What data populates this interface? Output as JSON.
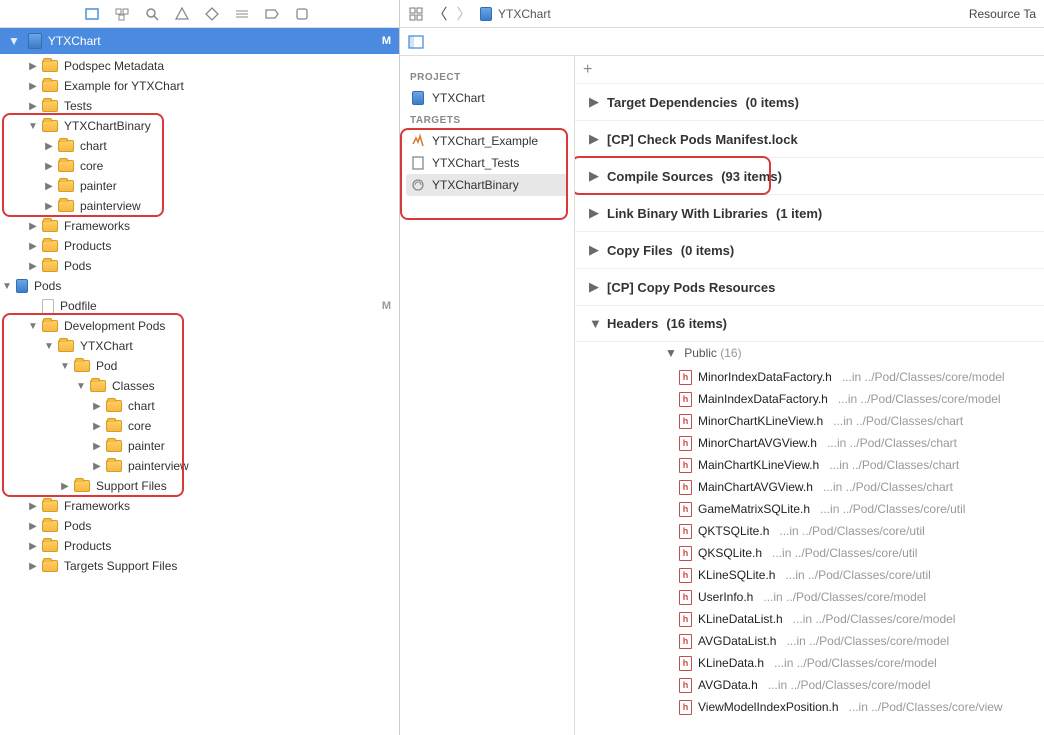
{
  "header": {
    "project_root": "YTXChart",
    "badge": "M",
    "resource_tag": "Resource Ta"
  },
  "crumb": {
    "item": "YTXChart"
  },
  "sidebar": {
    "tree1": [
      {
        "indent": 0,
        "open": false,
        "icon": "folder",
        "label": "Podspec Metadata"
      },
      {
        "indent": 0,
        "open": false,
        "icon": "folder",
        "label": "Example for YTXChart"
      },
      {
        "indent": 0,
        "open": false,
        "icon": "folder",
        "label": "Tests"
      }
    ],
    "tree_binary": [
      {
        "indent": 0,
        "open": true,
        "icon": "folder",
        "label": "YTXChartBinary"
      },
      {
        "indent": 1,
        "open": false,
        "icon": "folder",
        "label": "chart"
      },
      {
        "indent": 1,
        "open": false,
        "icon": "folder",
        "label": "core"
      },
      {
        "indent": 1,
        "open": false,
        "icon": "folder",
        "label": "painter"
      },
      {
        "indent": 1,
        "open": false,
        "icon": "folder",
        "label": "painterview"
      }
    ],
    "tree2": [
      {
        "indent": 0,
        "open": false,
        "icon": "folder",
        "label": "Frameworks"
      },
      {
        "indent": 0,
        "open": false,
        "icon": "folder",
        "label": "Products"
      },
      {
        "indent": 0,
        "open": false,
        "icon": "folder",
        "label": "Pods"
      }
    ],
    "pods_root": {
      "label": "Pods"
    },
    "podfile": {
      "label": "Podfile",
      "badge": "M"
    },
    "dev_pods": [
      {
        "indent": 0,
        "open": true,
        "icon": "folder",
        "label": "Development Pods"
      },
      {
        "indent": 1,
        "open": true,
        "icon": "folder",
        "label": "YTXChart"
      },
      {
        "indent": 2,
        "open": true,
        "icon": "folder",
        "label": "Pod"
      },
      {
        "indent": 3,
        "open": true,
        "icon": "folder",
        "label": "Classes"
      },
      {
        "indent": 4,
        "open": false,
        "icon": "folder",
        "label": "chart"
      },
      {
        "indent": 4,
        "open": false,
        "icon": "folder",
        "label": "core"
      },
      {
        "indent": 4,
        "open": false,
        "icon": "folder",
        "label": "painter"
      },
      {
        "indent": 4,
        "open": false,
        "icon": "folder",
        "label": "painterview"
      },
      {
        "indent": 2,
        "open": false,
        "icon": "folder",
        "label": "Support Files"
      }
    ],
    "tree3": [
      {
        "indent": 0,
        "open": false,
        "icon": "folder",
        "label": "Frameworks"
      },
      {
        "indent": 0,
        "open": false,
        "icon": "folder",
        "label": "Pods"
      },
      {
        "indent": 0,
        "open": false,
        "icon": "folder",
        "label": "Products"
      },
      {
        "indent": 0,
        "open": false,
        "icon": "folder",
        "label": "Targets Support Files"
      }
    ]
  },
  "targets": {
    "project_label": "PROJECT",
    "project_name": "YTXChart",
    "targets_label": "TARGETS",
    "items": [
      {
        "name": "YTXChart_Example"
      },
      {
        "name": "YTXChart_Tests"
      },
      {
        "name": "YTXChartBinary",
        "selected": true
      }
    ]
  },
  "phases": [
    {
      "name": "Target Dependencies",
      "count": "(0 items)",
      "open": false
    },
    {
      "name": "[CP] Check Pods Manifest.lock",
      "count": "",
      "open": false
    },
    {
      "name": "Compile Sources",
      "count": "(93 items)",
      "open": false,
      "highlight": true
    },
    {
      "name": "Link Binary With Libraries",
      "count": "(1 item)",
      "open": false
    },
    {
      "name": "Copy Files",
      "count": "(0 items)",
      "open": false
    },
    {
      "name": "[CP] Copy Pods Resources",
      "count": "",
      "open": false
    }
  ],
  "headers_phase": {
    "name": "Headers",
    "count": "(16 items)"
  },
  "headers_group": {
    "name": "Public",
    "count": "(16)"
  },
  "headers": [
    {
      "file": "MinorIndexDataFactory.h",
      "path": "...in ../Pod/Classes/core/model"
    },
    {
      "file": "MainIndexDataFactory.h",
      "path": "...in ../Pod/Classes/core/model"
    },
    {
      "file": "MinorChartKLineView.h",
      "path": "...in ../Pod/Classes/chart"
    },
    {
      "file": "MinorChartAVGView.h",
      "path": "...in ../Pod/Classes/chart"
    },
    {
      "file": "MainChartKLineView.h",
      "path": "...in ../Pod/Classes/chart"
    },
    {
      "file": "MainChartAVGView.h",
      "path": "...in ../Pod/Classes/chart"
    },
    {
      "file": "GameMatrixSQLite.h",
      "path": "...in ../Pod/Classes/core/util"
    },
    {
      "file": "QKTSQLite.h",
      "path": "...in ../Pod/Classes/core/util"
    },
    {
      "file": "QKSQLite.h",
      "path": "...in ../Pod/Classes/core/util"
    },
    {
      "file": "KLineSQLite.h",
      "path": "...in ../Pod/Classes/core/util"
    },
    {
      "file": "UserInfo.h",
      "path": "...in ../Pod/Classes/core/model"
    },
    {
      "file": "KLineDataList.h",
      "path": "...in ../Pod/Classes/core/model"
    },
    {
      "file": "AVGDataList.h",
      "path": "...in ../Pod/Classes/core/model"
    },
    {
      "file": "KLineData.h",
      "path": "...in ../Pod/Classes/core/model"
    },
    {
      "file": "AVGData.h",
      "path": "...in ../Pod/Classes/core/model"
    },
    {
      "file": "ViewModelIndexPosition.h",
      "path": "...in ../Pod/Classes/core/view"
    }
  ]
}
